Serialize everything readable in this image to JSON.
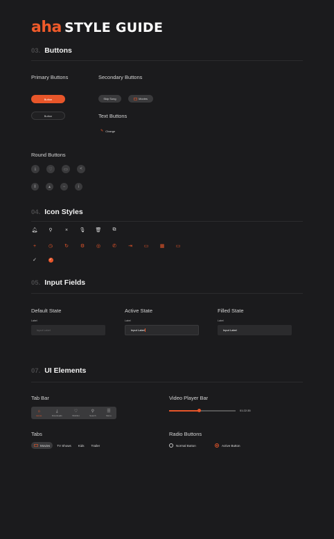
{
  "header": {
    "logo": "aha",
    "title": "STYLE GUIDE"
  },
  "buttons": {
    "num": "03.",
    "title": "Buttons",
    "primary_heading": "Primary Buttons",
    "secondary_heading": "Secondary Buttons",
    "text_heading": "Text Buttons",
    "round_heading": "Round Buttons",
    "primary_label": "Button",
    "outline_label": "Button",
    "skip_label": "Skip Song",
    "movies_label": "Movies",
    "change_label": "Change"
  },
  "icons": {
    "num": "04.",
    "title": "Icon Styles"
  },
  "inputs": {
    "num": "05.",
    "title": "Input Fields",
    "default_heading": "Default State",
    "active_heading": "Active State",
    "filled_heading": "Filled State",
    "label": "Label",
    "default_value": "Input Label",
    "active_value": "Input Label",
    "filled_value": "Input Label"
  },
  "ui": {
    "num": "07.",
    "title": "UI Elements",
    "tabbar_heading": "Tab Bar",
    "video_heading": "Video Player Bar",
    "tabs_heading": "Tabs",
    "radio_heading": "Radio Buttons",
    "tabbar_items": [
      {
        "label": "Home",
        "icon": "home-icon"
      },
      {
        "label": "Downloads",
        "icon": "download-icon"
      },
      {
        "label": "Wishlist",
        "icon": "heart-icon"
      },
      {
        "label": "Search",
        "icon": "search-icon"
      },
      {
        "label": "Menu",
        "icon": "menu-icon"
      }
    ],
    "video_time": "01:22:35",
    "video_progress": 0.45,
    "tabs": [
      "Movies",
      "TV Shows",
      "Kids",
      "Trailer"
    ],
    "radio_normal": "Normal Button",
    "radio_active": "Active Button"
  },
  "colors": {
    "accent": "#e8562a",
    "bg": "#1b1b1d"
  }
}
